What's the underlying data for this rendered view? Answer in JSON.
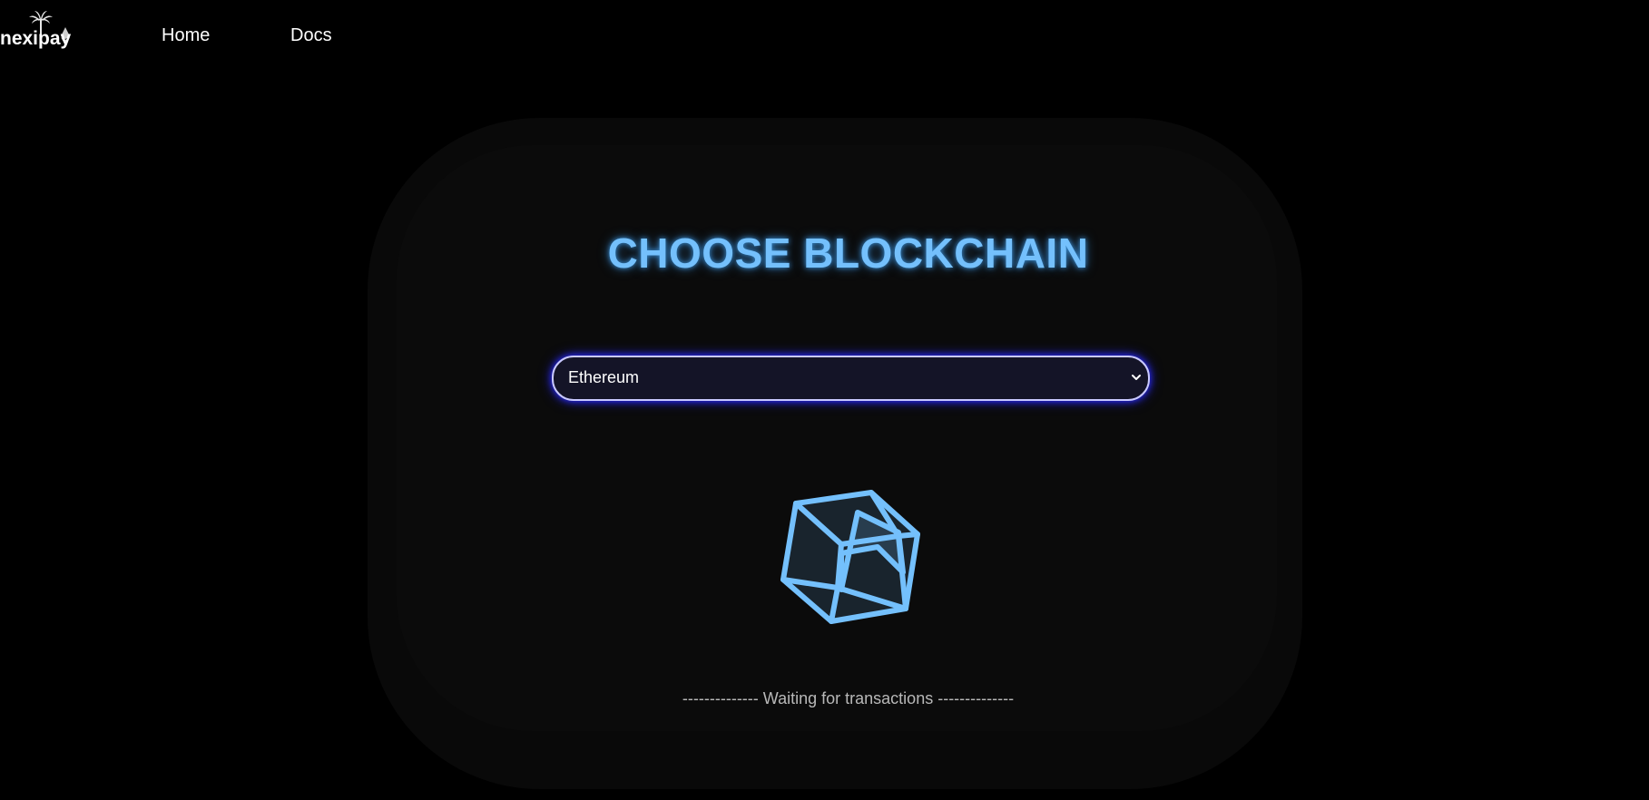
{
  "nav": {
    "logo_text": "nexipay",
    "home_label": "Home",
    "docs_label": "Docs"
  },
  "main": {
    "title": "CHOOSE BLOCKCHAIN",
    "blockchain_select": {
      "selected": "Ethereum"
    },
    "status_text": "-------------- Waiting for transactions --------------"
  },
  "icons": {
    "logo": "palm-tree-ethereum-logo",
    "select_arrow": "chevron-down-icon",
    "loader": "cube-icon"
  },
  "colors": {
    "accent": "#74c0fc",
    "select_glow": "#2a2aff",
    "background": "#000000"
  }
}
